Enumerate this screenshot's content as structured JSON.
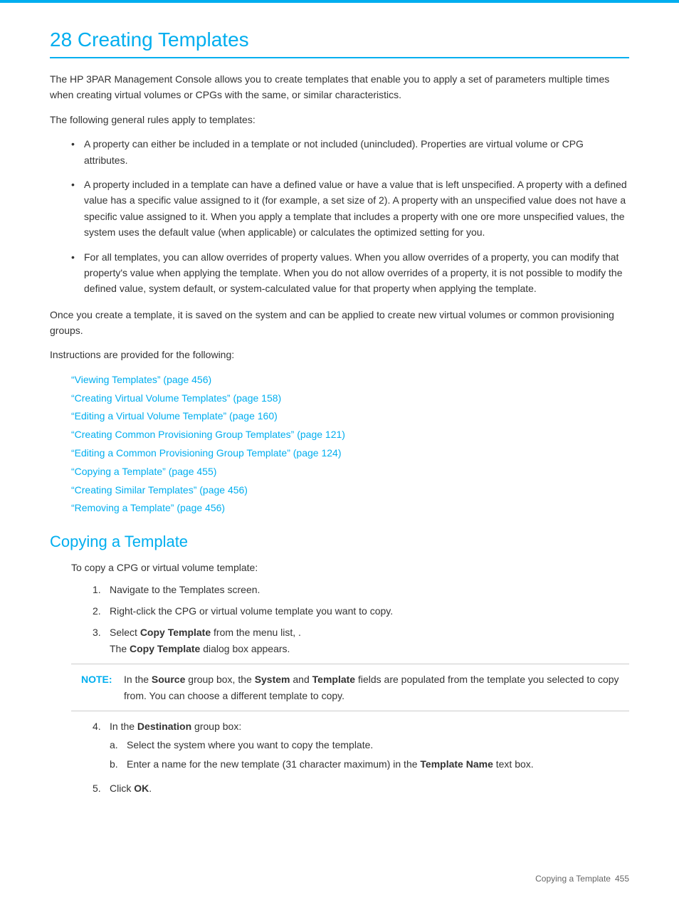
{
  "page": {
    "top_border_color": "#00aeef",
    "chapter_title": "28 Creating Templates",
    "intro_paragraph1": "The HP 3PAR Management Console allows you to create templates that enable you to apply a set of parameters multiple times when creating virtual volumes or CPGs with the same, or similar characteristics.",
    "intro_paragraph2": "The following general rules apply to templates:",
    "bullets": [
      "A property can either be included in a template or not included (unincluded). Properties are virtual volume or CPG attributes.",
      "A property included in a template can have a defined value or have a value that is left unspecified. A property with a defined value has a specific value assigned to it (for example, a set size of 2). A property with an unspecified value does not have a specific value assigned to it. When you apply a template that includes a property with one ore more unspecified values, the system uses the default value (when applicable) or calculates the optimized setting for you.",
      "For all templates, you can allow overrides of property values. When you allow overrides of a property, you can modify that property's value when applying the template. When you do not allow overrides of a property, it is not possible to modify the defined value, system default, or system-calculated value for that property when applying the template."
    ],
    "saved_text": "Once you create a template, it is saved on the system and can be applied to create new virtual volumes or common provisioning groups.",
    "instructions_label": "Instructions are provided for the following:",
    "links": [
      "“Viewing Templates” (page 456)",
      "“Creating Virtual Volume Templates” (page 158)",
      "“Editing a Virtual Volume Template” (page 160)",
      "“Creating Common Provisioning Group Templates” (page 121)",
      "“Editing a Common Provisioning Group Template” (page 124)",
      "“Copying a Template” (page 455)",
      "“Creating Similar Templates” (page 456)",
      "“Removing a Template” (page 456)"
    ],
    "section_title": "Copying a Template",
    "section_intro": "To copy a CPG or virtual volume template:",
    "steps": [
      {
        "num": "1.",
        "text": "Navigate to the Templates screen."
      },
      {
        "num": "2.",
        "text": "Right-click the CPG or virtual volume template you want to copy."
      },
      {
        "num": "3.",
        "text_before": "Select ",
        "bold1": "Copy Template",
        "text_middle": " from the menu list, .",
        "sub_text": "The ",
        "sub_bold": "Copy Template",
        "sub_text2": " dialog box appears."
      }
    ],
    "note_label": "NOTE:",
    "note_text_before": "In the ",
    "note_bold1": "Source",
    "note_text1": " group box, the ",
    "note_bold2": "System",
    "note_text2": " and ",
    "note_bold3": "Template",
    "note_text3": " fields are populated from the template you selected to copy from. You can choose a different template to copy.",
    "step4_num": "4.",
    "step4_text_before": "In the ",
    "step4_bold": "Destination",
    "step4_text": " group box:",
    "step4_subs": [
      {
        "alpha": "a.",
        "text": "Select the system where you want to copy the template."
      },
      {
        "alpha": "b.",
        "text_before": "Enter a name for the new template (31 character maximum) in the ",
        "bold": "Template Name",
        "text_after": " text box."
      }
    ],
    "step5_num": "5.",
    "step5_text_before": "Click ",
    "step5_bold": "OK",
    "step5_text": ".",
    "footer_text": "Copying a Template",
    "footer_page": "455"
  }
}
